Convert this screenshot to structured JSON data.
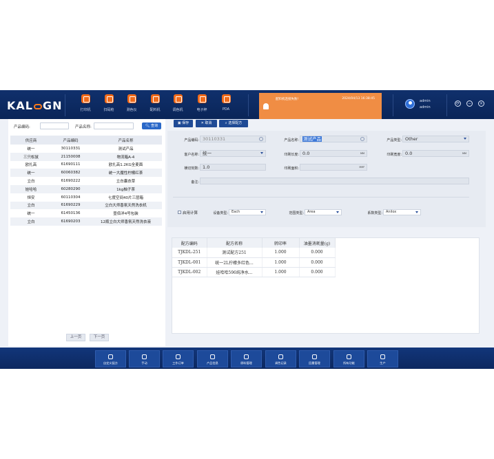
{
  "brand": {
    "text_a": "KAL",
    "text_b": "GN"
  },
  "top_nav": [
    {
      "label": "打印机"
    },
    {
      "label": "扫码枪"
    },
    {
      "label": "测色仪"
    },
    {
      "label": "配料机"
    },
    {
      "label": "调色机"
    },
    {
      "label": "电子秤"
    },
    {
      "label": "PDA"
    }
  ],
  "notice": {
    "title": "配料机连接失败!",
    "time": "2024/04/13 16:38:45"
  },
  "user": {
    "name": "admin",
    "role": "admin"
  },
  "window_controls": {
    "refresh": "⟳",
    "minimize": "−",
    "close": "×"
  },
  "search": {
    "code_label": "产品编码:",
    "name_label": "产品名称:",
    "query_button": "查询",
    "code_value": "",
    "name_value": ""
  },
  "product_table": {
    "headers": [
      "供应商",
      "产品编码",
      "产品名称"
    ],
    "rows": [
      [
        "统一",
        "30110331",
        "测试产品"
      ],
      [
        "三只松鼠",
        "21150008",
        "物流箱A-4"
      ],
      [
        "欧扎高",
        "61690111",
        "欧扎高1.2KG全麦面"
      ],
      [
        "统一",
        "60060382",
        "统一大魔性柠檬红茶"
      ],
      [
        "立白",
        "61690222",
        "立白囊衣草"
      ],
      [
        "娃哈哈",
        "60280290",
        "1kg柚子茶"
      ],
      [
        "恒安",
        "60110304",
        "七度空间40片三层箱"
      ],
      [
        "立白",
        "61690229",
        "立白大师香氛天然洗衣机"
      ],
      [
        "统一",
        "61450136",
        "壹佰洋4号包装"
      ],
      [
        "立白",
        "61690203",
        "12瓶立白大师香氛天然洗衣液"
      ]
    ]
  },
  "pagination": {
    "prev": "上一页",
    "next": "下一页"
  },
  "toolbar": {
    "save": "保存",
    "cancel": "取消",
    "select_recipe": "选择配方"
  },
  "form": {
    "product_code_label": "产品编码:",
    "product_code": "30110331",
    "product_name_label": "产品名称:",
    "product_name": "测试产品",
    "product_type_label": "产品类型:",
    "product_type": "Other",
    "customer_label": "客户名称:",
    "customer": "统一",
    "print_length_label": "印刷长度:",
    "print_length": "0.0",
    "print_length_unit": "MM",
    "print_width_label": "印刷宽度:",
    "print_width": "0.0",
    "print_width_unit": "MM",
    "cut_count_label": "横切刻数:",
    "cut_count": "1.0",
    "print_area_label": "印刷面积:",
    "print_area_unit": "MM²",
    "remark_label": "备注:",
    "remark": ""
  },
  "options": {
    "enable_calc_label": "启用计算",
    "device_type_label": "设备类型:",
    "device_type": "Each",
    "range_type_label": "范围类型:",
    "range_type": "Area",
    "coef_type_label": "系数类型:",
    "coef_type": "Anilox"
  },
  "recipe_table": {
    "headers": [
      "配方编码",
      "配方名称",
      "转印率",
      "油墨消耗量(g)"
    ],
    "rows": [
      [
        "TJKDL-251",
        "测试配方251",
        "1.000",
        "0.000"
      ],
      [
        "TJKDL-001",
        "统一2L拧檬多红色...",
        "1.000",
        "0.000"
      ],
      [
        "TJKDL-002",
        "娃哈哈596纯净水...",
        "1.000",
        "0.000"
      ]
    ]
  },
  "bottom_nav": [
    {
      "label": "自定义配方"
    },
    {
      "label": "手动"
    },
    {
      "label": "工作订单"
    },
    {
      "label": "产品信息"
    },
    {
      "label": "原料管理"
    },
    {
      "label": "调色记录"
    },
    {
      "label": "回墨管理"
    },
    {
      "label": "所有功能"
    },
    {
      "label": "生产"
    }
  ]
}
